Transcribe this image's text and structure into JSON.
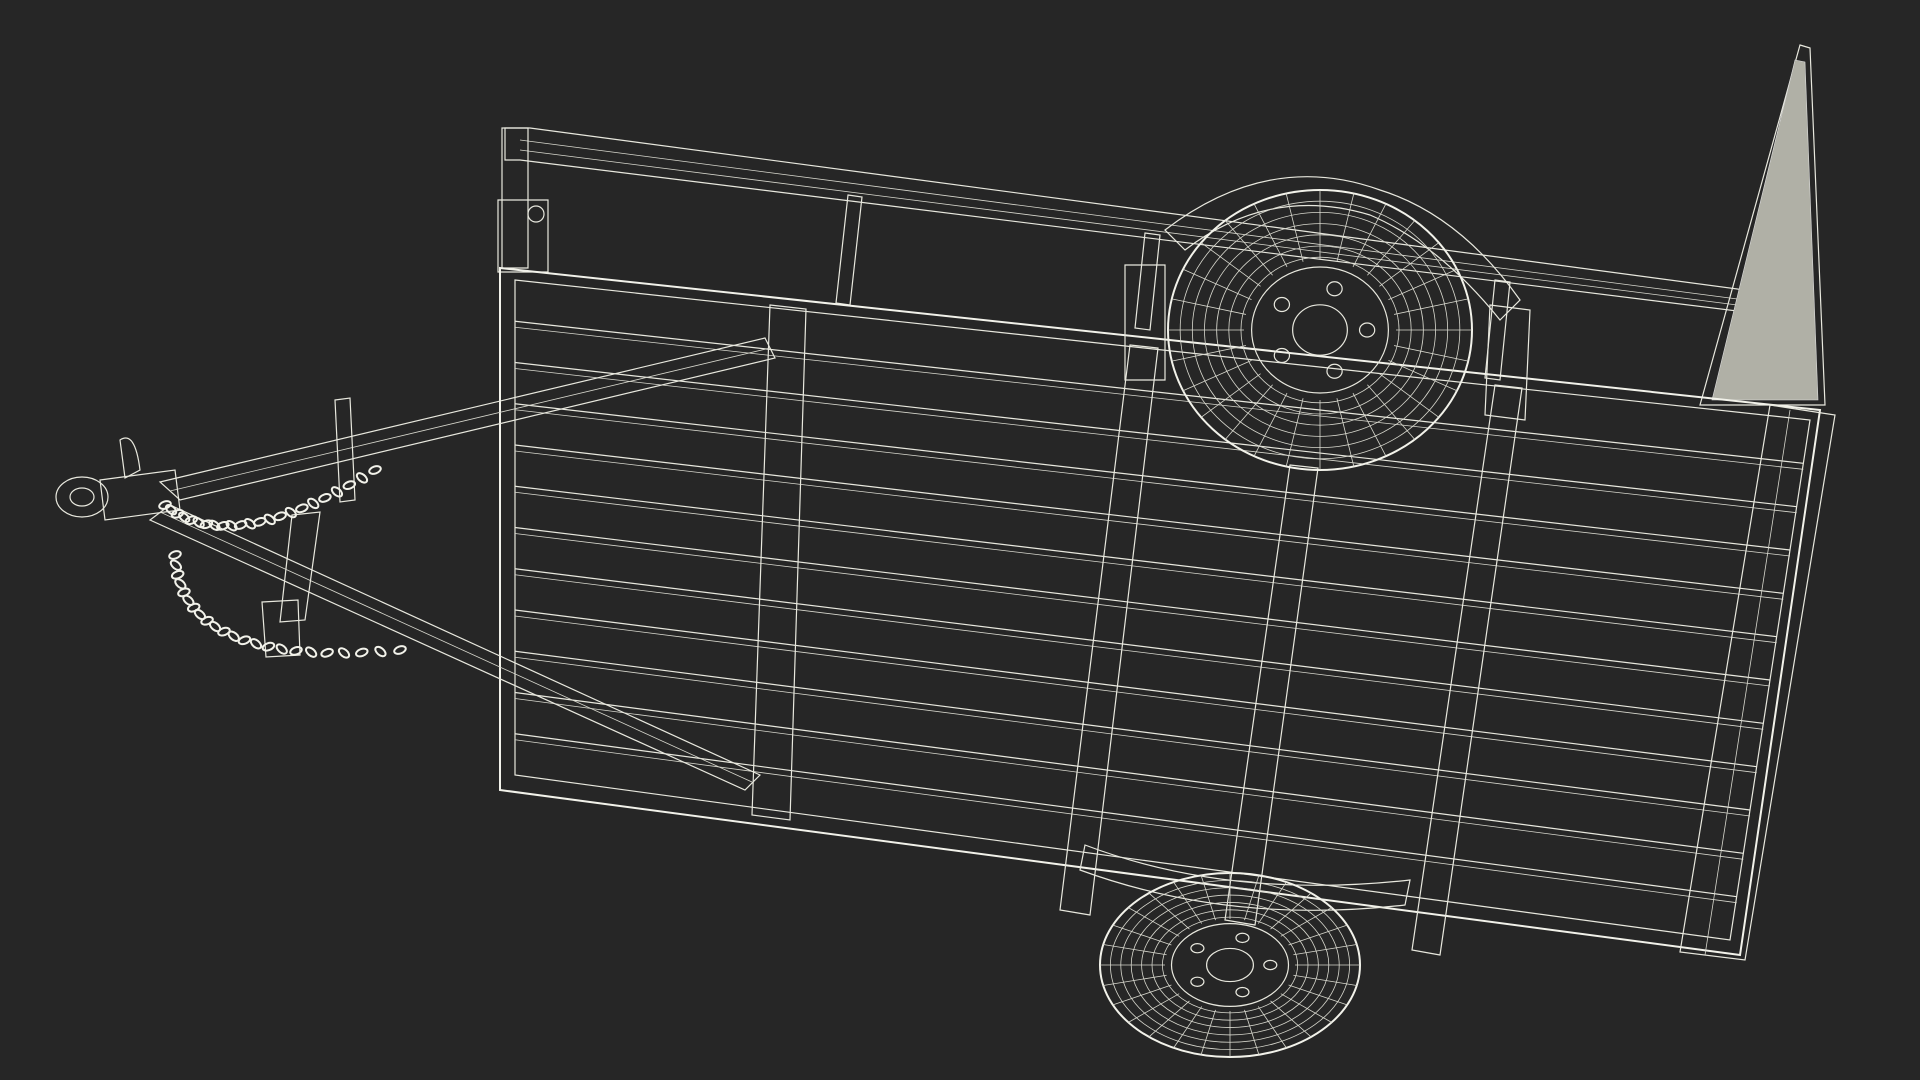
{
  "scene": {
    "subject": "utility-trailer-wireframe",
    "background_color": "#262626",
    "model_fill_color": "#8f8f86",
    "wire_color": "#e8e8de",
    "plank_count": 12,
    "tire_ring_count": 6,
    "tire_spoke_count": 28,
    "chain_link_count": 22
  }
}
